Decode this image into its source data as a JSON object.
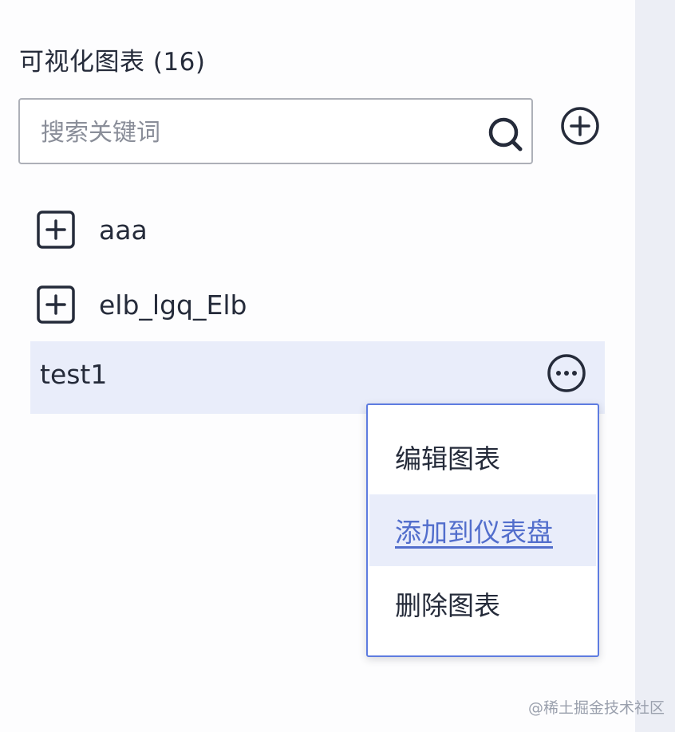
{
  "panel": {
    "title": "可视化图表 (16)"
  },
  "search": {
    "placeholder": "搜索关键词",
    "value": ""
  },
  "icons": {
    "search": "search-icon",
    "add": "plus-circle-icon",
    "expand": "plus-square-icon",
    "more": "more-horizontal-circle-icon"
  },
  "tree": {
    "items": [
      {
        "label": "aaa",
        "expandable": true
      },
      {
        "label": "elb_lgq_Elb",
        "expandable": true
      },
      {
        "label": "test1",
        "expandable": false,
        "selected": true
      }
    ]
  },
  "context_menu": {
    "items": [
      {
        "label": "编辑图表",
        "hovered": false
      },
      {
        "label": "添加到仪表盘",
        "hovered": true
      },
      {
        "label": "删除图表",
        "hovered": false
      }
    ]
  },
  "watermark": {
    "text": "@稀土掘金技术社区"
  },
  "colors": {
    "text": "#252b3a",
    "border": "#adb0b8",
    "selected_bg": "#e9edfa",
    "accent": "#5e7ce0",
    "link": "#526ecc",
    "placeholder": "#8a8e99"
  }
}
